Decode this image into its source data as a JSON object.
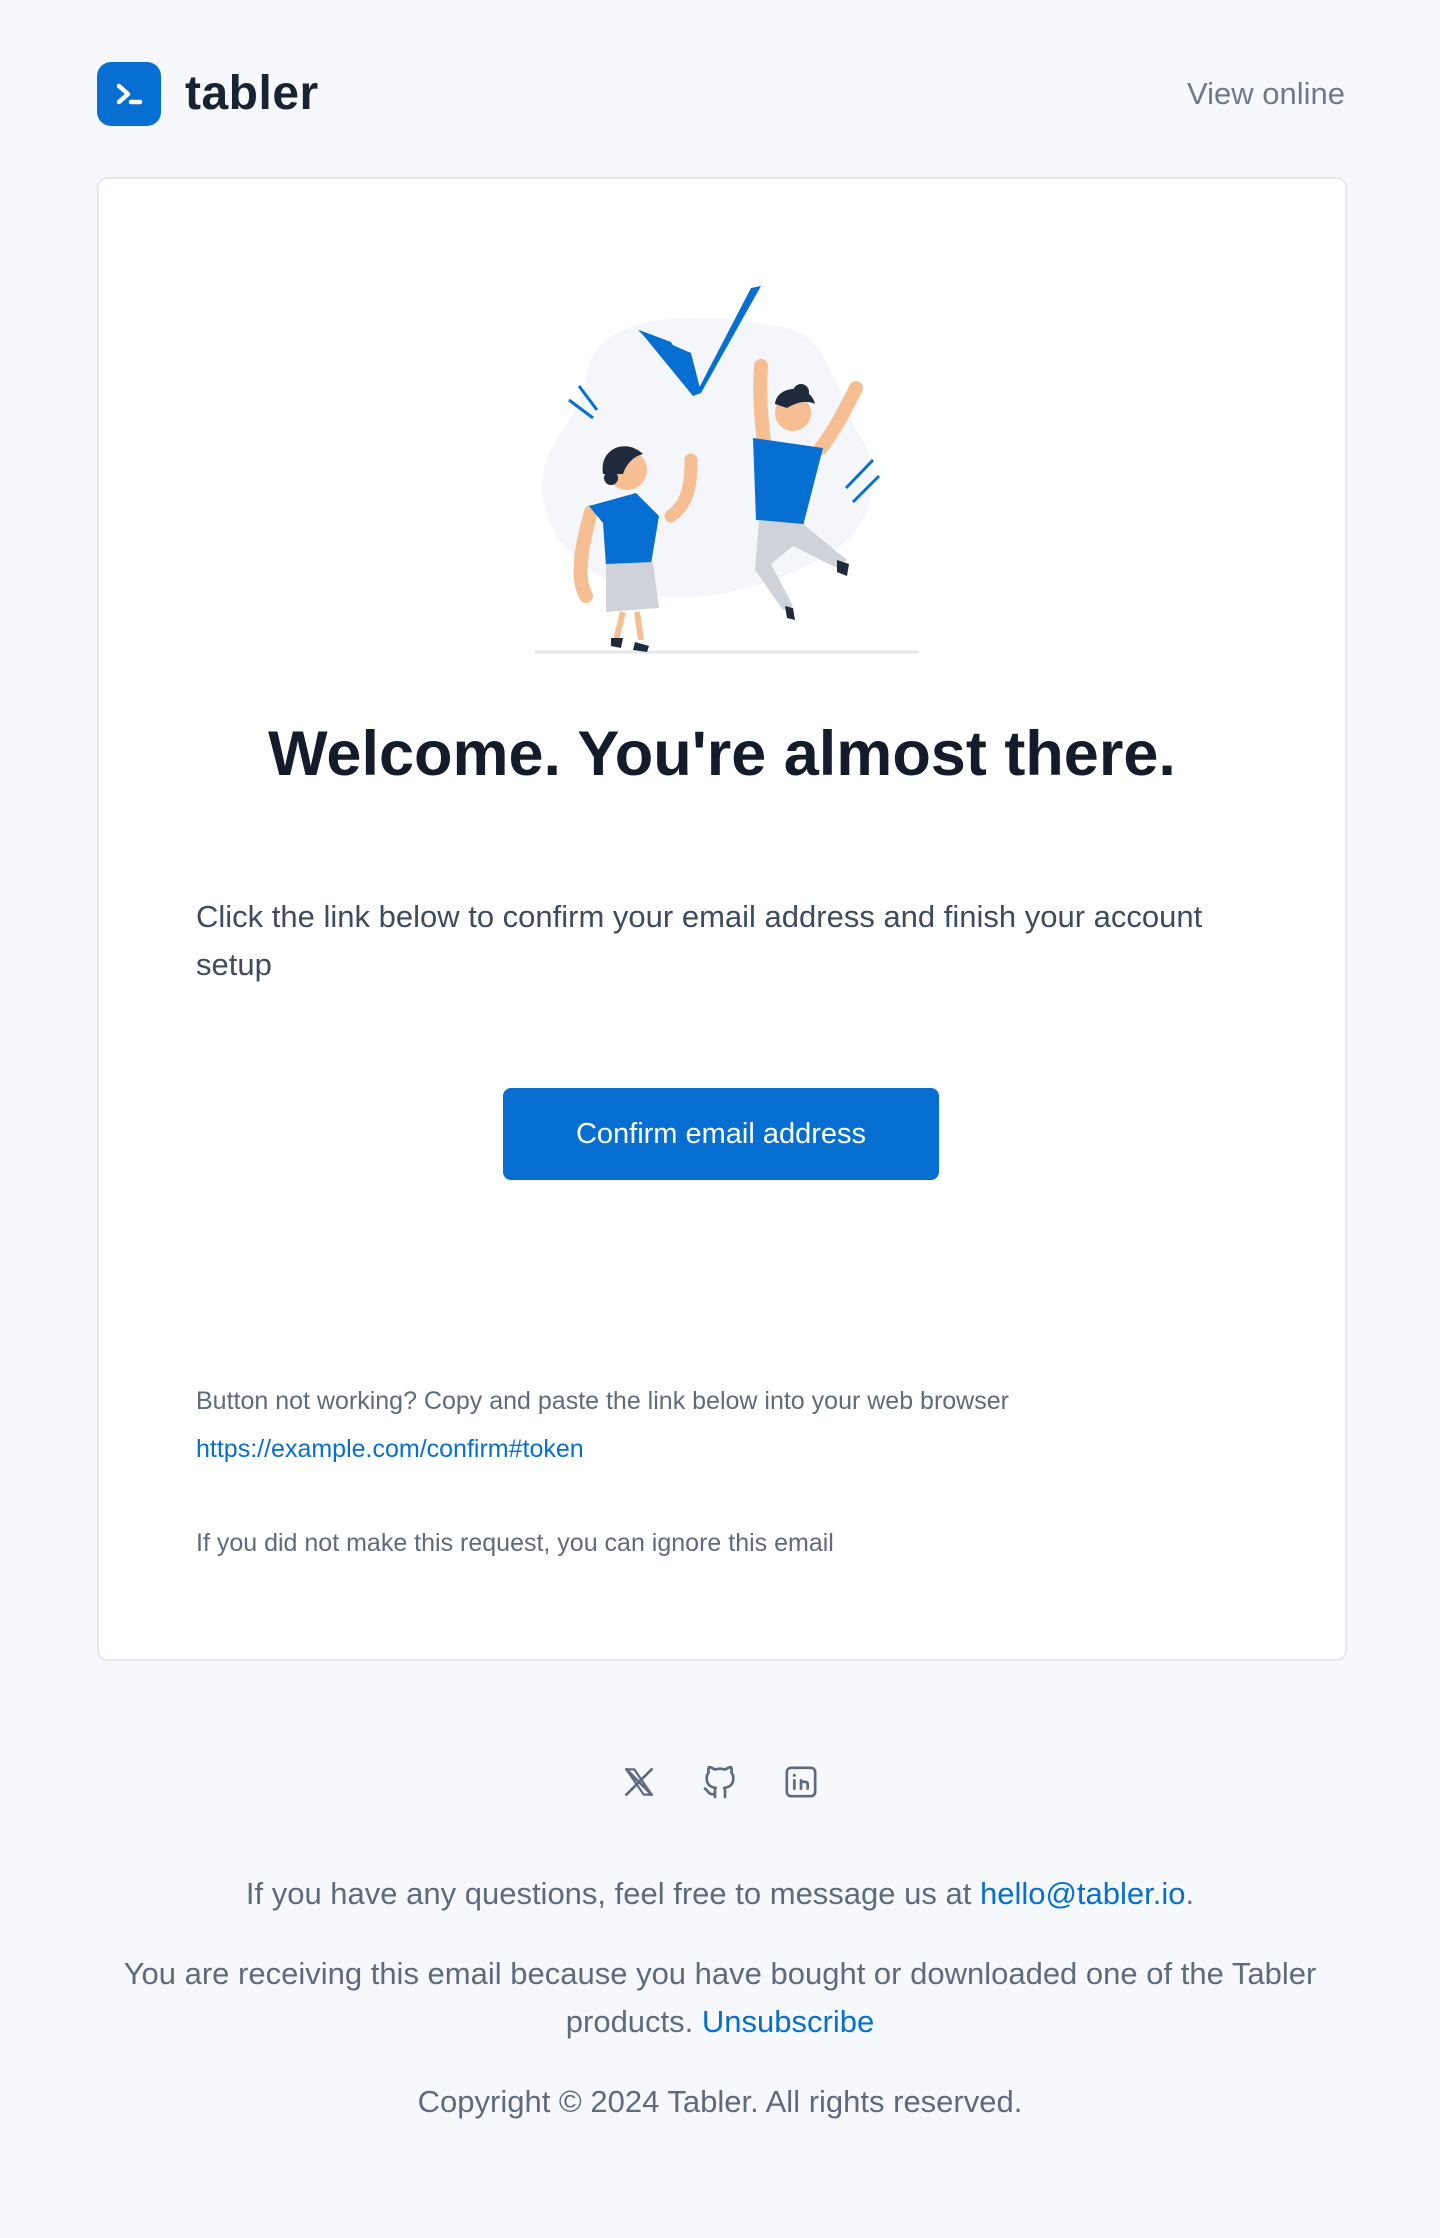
{
  "header": {
    "brand_name": "tabler",
    "view_online": "View online"
  },
  "card": {
    "title": "Welcome. You're almost there.",
    "intro": "Click the link below to confirm your email address and finish your account setup",
    "confirm_button": "Confirm email address",
    "fallback_text": "Button not working? Copy and paste the link below into your web browser",
    "fallback_link": "https://example.com/confirm#token",
    "ignore_text": "If you did not make this request, you can ignore this email"
  },
  "social": [
    "x-icon",
    "github-icon",
    "linkedin-icon"
  ],
  "footer": {
    "questions_prefix": "If you have any questions, feel free to message us at ",
    "email": "hello@tabler.io",
    "questions_suffix": ".",
    "receiving_text": "You are receiving this email because you have bought or downloaded one of the Tabler products.",
    "unsubscribe": "Unsubscribe",
    "copyright": "Copyright © 2024 Tabler. All rights reserved."
  },
  "colors": {
    "accent": "#066fd1",
    "background": "#f7f8fb",
    "heading": "#141c2b",
    "muted_text": "#5f6b7c"
  }
}
